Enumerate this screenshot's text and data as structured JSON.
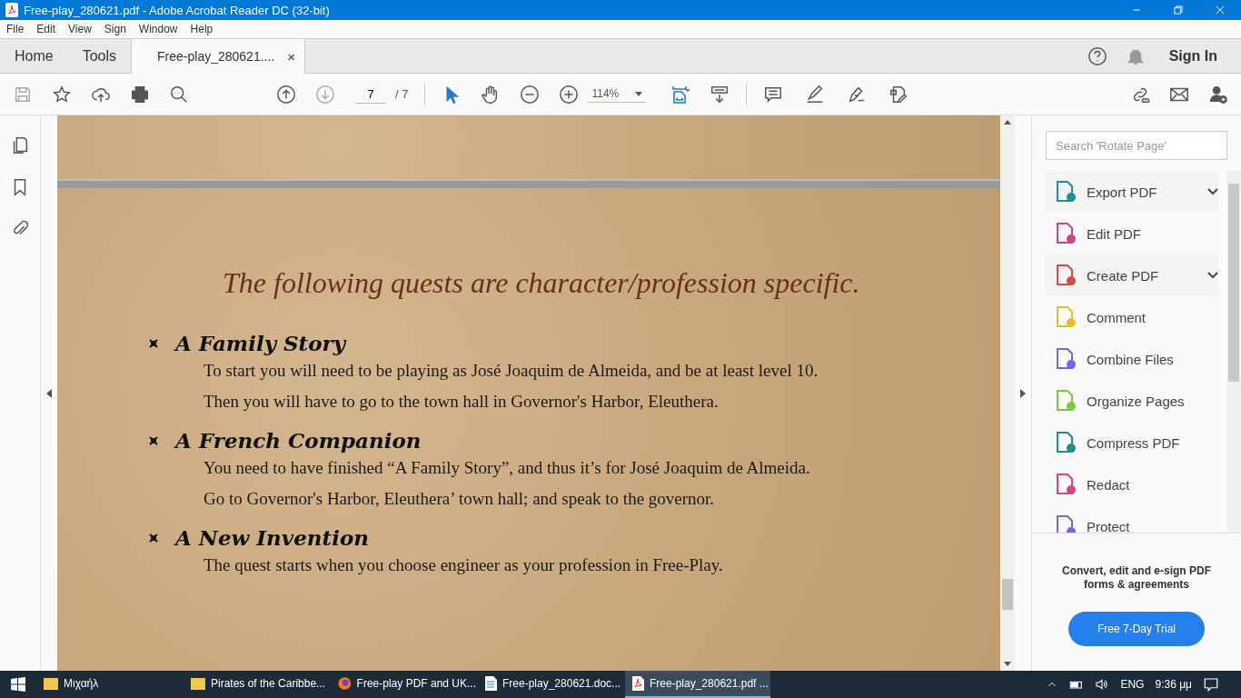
{
  "window": {
    "title": "Free-play_280621.pdf - Adobe Acrobat Reader DC (32-bit)"
  },
  "menu": [
    "File",
    "Edit",
    "View",
    "Sign",
    "Window",
    "Help"
  ],
  "tabs": [
    {
      "label": "Home",
      "selected": false,
      "kind": "nav"
    },
    {
      "label": "Tools",
      "selected": false,
      "kind": "nav"
    },
    {
      "label": "Free-play_280621....",
      "selected": true,
      "kind": "document",
      "close": "×"
    }
  ],
  "sign_in": "Sign In",
  "page_nav": {
    "current": "7",
    "total": "/ 7"
  },
  "zoom": "114%",
  "document": {
    "heading": "The following quests are character/profession specific.",
    "quests": [
      {
        "title": "A Family Story",
        "lines": [
          "To start you will need to be playing as José Joaquim de Almeida, and be at least level 10.",
          "Then you will have to go to the town hall in Governor's Harbor, Eleuthera."
        ]
      },
      {
        "title": "A French Companion",
        "lines": [
          "You need to have finished “A Family Story”, and thus it’s for José Joaquim de Almeida.",
          "Go to Governor's Harbor, Eleuthera’ town hall; and speak to the governor."
        ]
      },
      {
        "title": "A New Invention",
        "lines": [
          "The quest starts when you choose engineer as your profession in Free-Play."
        ]
      }
    ]
  },
  "tools_pane": {
    "search": {
      "placeholder": "Search 'Rotate Page'"
    },
    "tools": [
      {
        "label": "Export PDF",
        "color": "#17928f",
        "expandable": true
      },
      {
        "label": "Edit PDF",
        "color": "#d8408f",
        "expandable": false
      },
      {
        "label": "Create PDF",
        "color": "#e0474c",
        "expandable": true
      },
      {
        "label": "Comment",
        "color": "#e2bf2c",
        "expandable": false
      },
      {
        "label": "Combine Files",
        "color": "#6e6ae5",
        "expandable": false
      },
      {
        "label": "Organize Pages",
        "color": "#7ac943",
        "expandable": false
      },
      {
        "label": "Compress PDF",
        "color": "#17928f",
        "expandable": false
      },
      {
        "label": "Redact",
        "color": "#de4189",
        "expandable": false
      },
      {
        "label": "Protect",
        "color": "#6e6ae5",
        "expandable": false
      }
    ],
    "promo": "Convert, edit and e-sign PDF forms & agreements",
    "trial_button": "Free 7-Day Trial"
  },
  "taskbar": {
    "items": [
      {
        "label": "Μιχαήλ",
        "kind": "folder",
        "selected": false
      },
      {
        "label": "Pirates of the Caribbe...",
        "kind": "folder",
        "selected": false
      },
      {
        "label": "Free-play PDF and UK...",
        "kind": "browser",
        "selected": false
      },
      {
        "label": "Free-play_280621.doc...",
        "kind": "document",
        "selected": false
      },
      {
        "label": "Free-play_280621.pdf ...",
        "kind": "pdf",
        "selected": true
      }
    ],
    "language": "ENG",
    "clock": "9:36 μμ"
  }
}
